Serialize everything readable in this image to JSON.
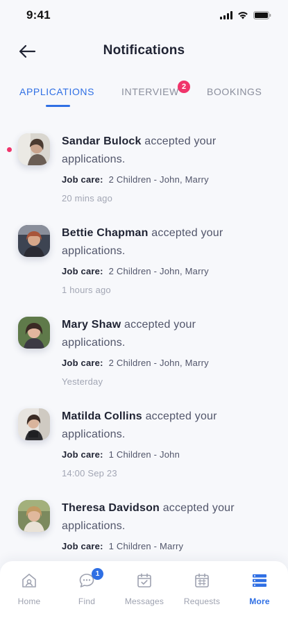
{
  "status_bar": {
    "time": "9:41"
  },
  "header": {
    "title": "Notifications"
  },
  "tabs": [
    {
      "label": "APPLICATIONS",
      "active": true
    },
    {
      "label": "INTERVIEW",
      "badge": "2"
    },
    {
      "label": "BOOKINGS"
    }
  ],
  "notifications": [
    {
      "name": "Sandar Bulock",
      "text_tail": "accepted your",
      "text_line2": "applications.",
      "job_label": "Job care:",
      "job_value": "2 Children - John, Marry",
      "time": "20 mins ago",
      "unread": true
    },
    {
      "name": "Bettie Chapman",
      "text_tail": "accepted your",
      "text_line2": "applications.",
      "job_label": "Job care:",
      "job_value": "2 Children - John, Marry",
      "time": "1 hours ago"
    },
    {
      "name": "Mary Shaw",
      "text_tail": "accepted your",
      "text_line2": "applications.",
      "job_label": "Job care:",
      "job_value": "2 Children - John, Marry",
      "time": "Yesterday"
    },
    {
      "name": "Matilda Collins",
      "text_tail": "accepted your",
      "text_line2": "applications.",
      "job_label": "Job care:",
      "job_value": "1 Children - John",
      "time": "14:00 Sep 23"
    },
    {
      "name": "Theresa Davidson",
      "text_tail": "accepted your",
      "text_line2": "applications.",
      "job_label": "Job care:",
      "job_value": "1 Children - Marry",
      "time": ""
    }
  ],
  "bottom_nav": [
    {
      "label": "Home",
      "icon": "home-icon"
    },
    {
      "label": "Find",
      "icon": "chat-icon",
      "badge": "1"
    },
    {
      "label": "Messages",
      "icon": "calendar-check-icon"
    },
    {
      "label": "Requests",
      "icon": "calendar-grid-icon"
    },
    {
      "label": "More",
      "icon": "menu-icon",
      "active": true
    }
  ],
  "colors": {
    "accent": "#2f6fe4",
    "badge": "#f0346b",
    "background": "#f7f8fb"
  }
}
